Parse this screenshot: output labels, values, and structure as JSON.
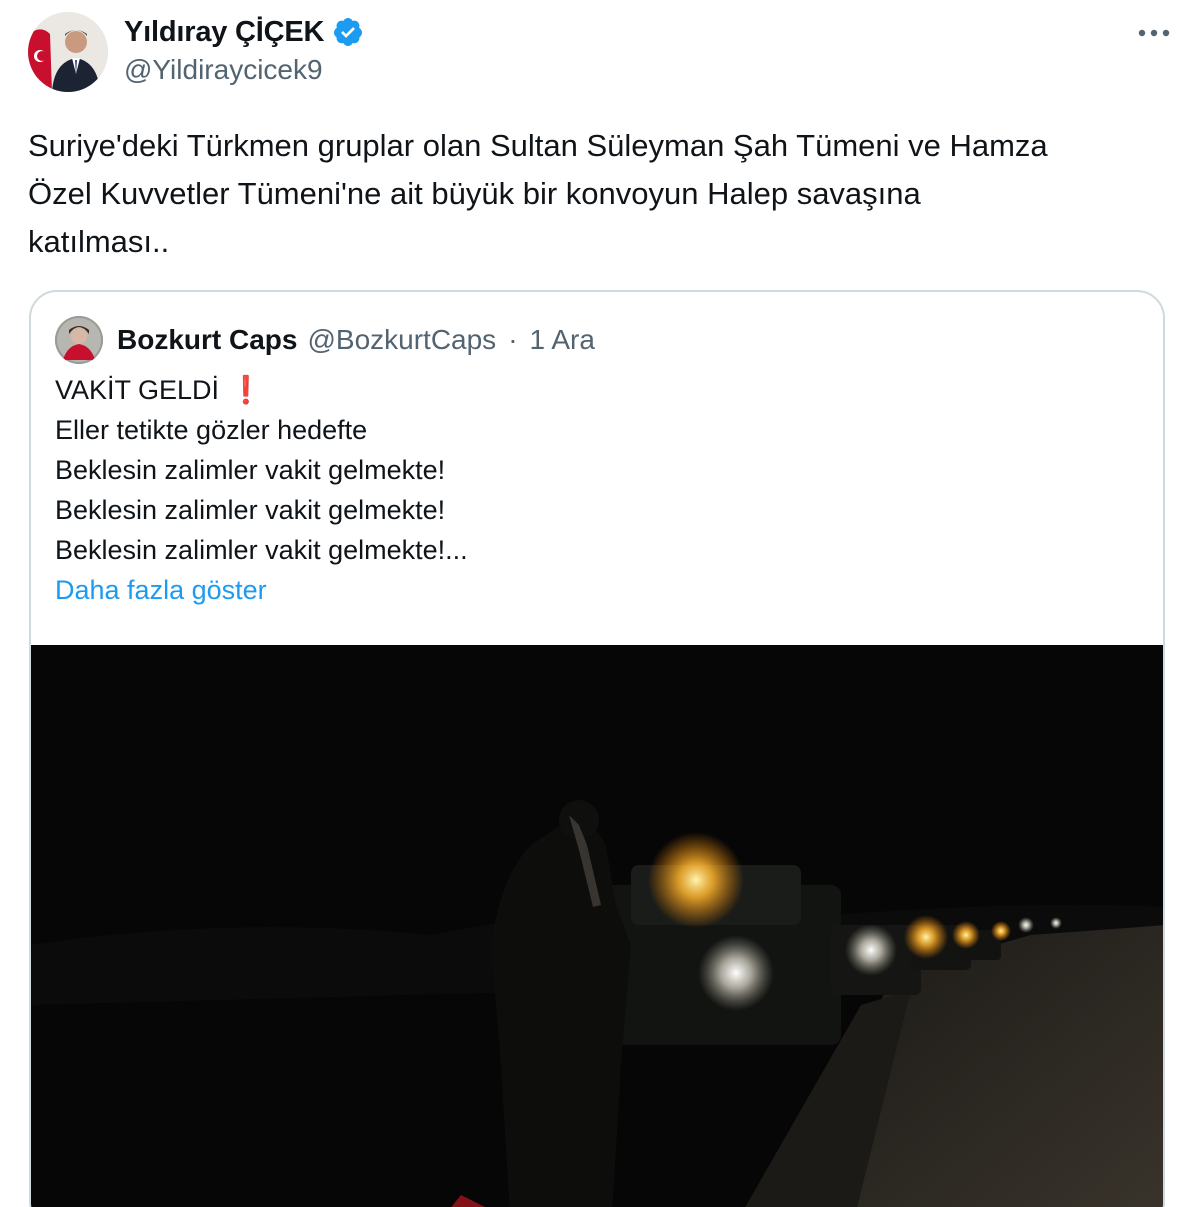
{
  "author": {
    "display_name": "Yıldıray ÇİÇEK",
    "handle": "@Yildiraycicek9",
    "verified": true,
    "verified_color": "#1d9bf0"
  },
  "more_icon": "more-horizontal-icon",
  "tweet": {
    "text": "Suriye'deki Türkmen gruplar olan Sultan Süleyman Şah Tümeni ve Hamza\nÖzel Kuvvetler Tümeni'ne ait büyük bir konvoyun Halep savaşına\nkatılması.."
  },
  "quote": {
    "display_name": "Bozkurt Caps",
    "handle": "@BozkurtCaps",
    "separator": "·",
    "date": "1 Ara",
    "lines": [
      "VAKİT GELDİ",
      "Eller tetikte gözler hedefte",
      "Beklesin zalimler vakit gelmekte!",
      "Beklesin zalimler vakit gelmekte!",
      "Beklesin zalimler vakit gelmekte!..."
    ],
    "emoji": "❗",
    "show_more": "Daha fazla göster",
    "link_color": "#1d9bf0"
  }
}
